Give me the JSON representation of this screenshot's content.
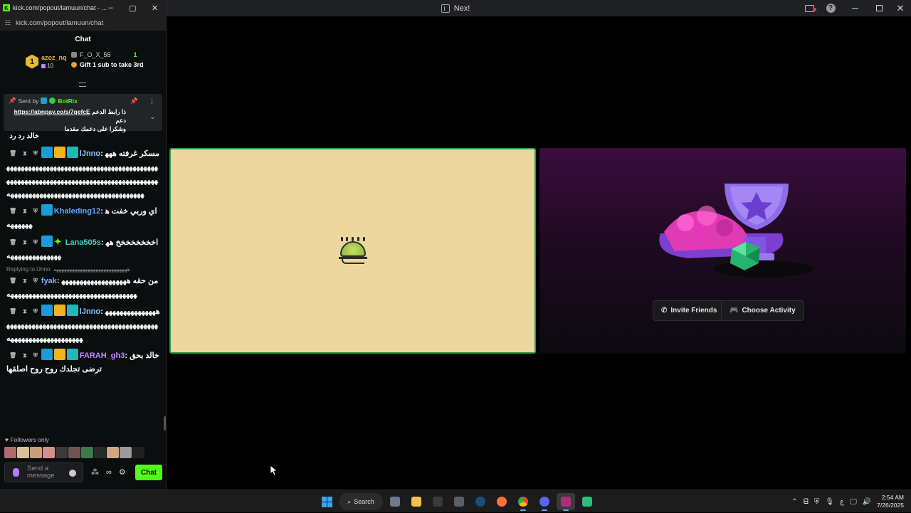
{
  "nex": {
    "title": "Nex!",
    "invite_label": "Invite Friends",
    "activity_label": "Choose Activity",
    "colors": {
      "left_panel_bg": "#ecd89f",
      "left_panel_border": "#2f9a46",
      "right_panel_bg": "#3a0d3d"
    }
  },
  "kick": {
    "window_title": "kick.com/popout/lamuun/chat - ...",
    "url": "kick.com/popout/lamuun/chat",
    "chat_title": "Chat",
    "leaderboard": {
      "rank": "1",
      "top_user": "azoz_nq",
      "top_count": "10",
      "second_user": "F_O_X_55",
      "second_count": "1",
      "gift_text": "Gift 1 sub to take 3rd"
    },
    "pinned": {
      "sent_by_label": "Sent by",
      "bot_name": "BotRix",
      "line1_pre": "ذا رابط الدعم",
      "link": "https://abnpay.co/s/7qefcE",
      "line1_post": "دعم",
      "line2": "وشكرا على دعمك مقدما"
    },
    "messages": [
      {
        "user": "",
        "text": "خالد رد رد"
      },
      {
        "user": "lJnno",
        "text": "مسكر غرفته ههههههههههههههههههههههههههههههههههههههههههههههههههههههههههههههههههههههههههههههههههههههههههههههههههههههههههههههههههههههههههههه"
      },
      {
        "user": "Khaleding12",
        "text": "اي وربي خفت هههههههه"
      },
      {
        "user": "Lana505s",
        "text": "اخخخخخخخخ ههههههههههههههههه"
      },
      {
        "reply_label": "Replying to lJnno: ههههههههههههههههههههههههههههه",
        "user": "fyak",
        "text": "من حقه ههههههههههههههههههههههههههههههههههههههههههههههههههههههه"
      },
      {
        "user": "lJnno",
        "text": "هههههههههههههههههههههههههههههههههههههههههههههههههههههههههههههههههههههههههههههه"
      },
      {
        "user": "FARAH_gh3",
        "text": "خالد بحق ترضى تجلدك روح روح اصلقها"
      }
    ],
    "followers_label": "Followers only",
    "input_placeholder": "Send a message",
    "send_label": "Chat"
  },
  "taskbar": {
    "search_label": "Search",
    "lang": "ع",
    "time": "2:54 AM",
    "date": "7/26/2025"
  }
}
